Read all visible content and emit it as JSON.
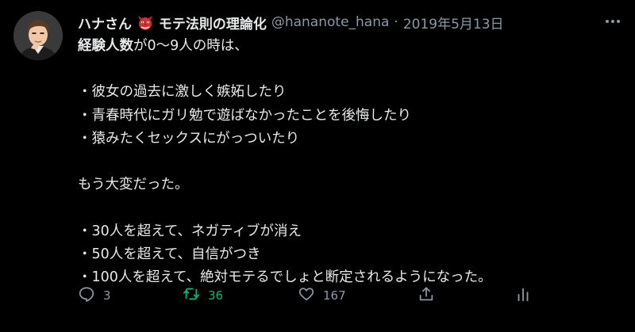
{
  "tweet": {
    "display_name_part1": "ハナさん",
    "display_name_part2": "モテ法則の理論化",
    "emoji_icon": "goblin-mask-icon",
    "handle": "@hananote_hana",
    "separator": "·",
    "date": "2019年5月13日",
    "lines": [
      {
        "bold": "経験人数",
        "text": "が0〜9人の時は、"
      },
      {
        "bold": "",
        "text": ""
      },
      {
        "bold": "",
        "text": "・彼女の過去に激しく嫉妬したり"
      },
      {
        "bold": "",
        "text": "・青春時代にガリ勉で遊ばなかったことを後悔したり"
      },
      {
        "bold": "",
        "text": "・猿みたくセックスにがっついたり"
      },
      {
        "bold": "",
        "text": ""
      },
      {
        "bold": "",
        "text": "もう大変だった。"
      },
      {
        "bold": "",
        "text": ""
      },
      {
        "bold": "",
        "text": "・30人を超えて、ネガティブが消え"
      },
      {
        "bold": "",
        "text": "・50人を超えて、自信がつき"
      },
      {
        "bold": "",
        "text": "・100人を超えて、絶対モテるでしょと断定されるようになった。"
      }
    ],
    "actions": {
      "reply_count": "3",
      "retweet_count": "36",
      "like_count": "167"
    },
    "colors": {
      "background": "#000000",
      "text": "#e7e9ea",
      "secondary": "#8b98a5",
      "retweet": "#00ba7c"
    }
  }
}
